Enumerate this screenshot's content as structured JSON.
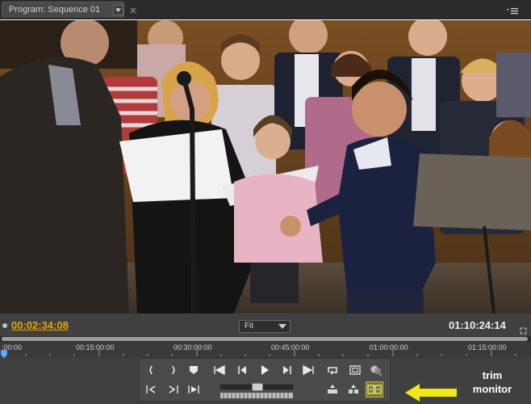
{
  "panel": {
    "tab_title": "Program: Sequence 01",
    "tab_menu_icon": "dropdown-arrow-icon",
    "tab_close_icon": "close-icon",
    "panel_menu_icon": "panel-menu-icon"
  },
  "monitor": {
    "current_time": "00:02:34:08",
    "zoom_level": "Fit",
    "duration": "01:10:24:14",
    "ruler_labels": [
      ":00:00",
      "00:15:00:00",
      "00:30:00:00",
      "00:45:00:00",
      "01:00:00:00",
      "01:15:00:00"
    ]
  },
  "transport_buttons": [
    {
      "name": "set-in-point-icon"
    },
    {
      "name": "set-out-point-icon"
    },
    {
      "name": "set-marker-icon"
    },
    {
      "name": "go-to-in-point-icon"
    },
    {
      "name": "step-back-icon"
    },
    {
      "name": "play-icon"
    },
    {
      "name": "step-forward-icon"
    },
    {
      "name": "go-to-out-point-icon"
    },
    {
      "name": "loop-icon"
    },
    {
      "name": "safe-margins-icon"
    },
    {
      "name": "output-icon"
    },
    {
      "name": "go-to-previous-marker-icon"
    },
    {
      "name": "go-to-next-marker-icon"
    },
    {
      "name": "play-in-to-out-icon"
    },
    {
      "name": "lift-icon"
    },
    {
      "name": "extract-icon"
    },
    {
      "name": "trim-monitor-icon"
    }
  ],
  "callout": {
    "line1": "trim",
    "line2": "monitor",
    "color": "#f0e81a"
  },
  "colors": {
    "timecode": "#e8a600",
    "panel_bg": "#404040",
    "active_button": "#7c7a1f"
  }
}
